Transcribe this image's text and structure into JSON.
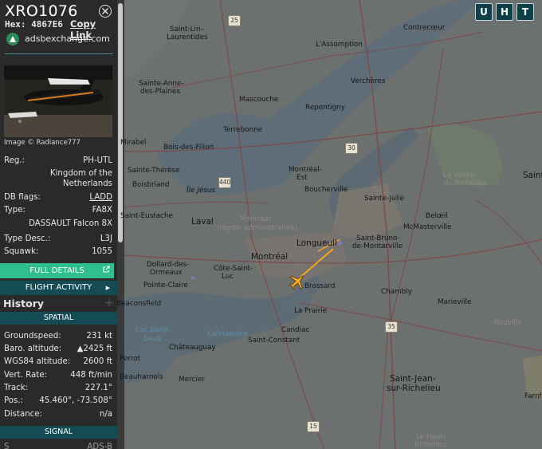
{
  "header": {
    "callsign": "XRO1076",
    "hex_label": "Hex:",
    "hex": "4867E6",
    "copy_link": "Copy Link",
    "source_site": "adsbexchange.com"
  },
  "photo": {
    "caption": "Image © Radiance777"
  },
  "details": {
    "reg_label": "Reg.:",
    "reg": "PH-UTL",
    "country": "Kingdom of the Netherlands",
    "db_flags_label": "DB flags:",
    "db_flags": "LADD",
    "type_label": "Type:",
    "type": "FA8X",
    "type_name": "DASSAULT Falcon 8X",
    "type_desc_label": "Type Desc.:",
    "type_desc": "L3J",
    "squawk_label": "Squawk:",
    "squawk": "1055"
  },
  "buttons": {
    "full_details": "FULL DETAILS",
    "flight_activity": "FLIGHT ACTIVITY"
  },
  "history": {
    "title": "History"
  },
  "spatial": {
    "title": "SPATIAL",
    "groundspeed_label": "Groundspeed:",
    "groundspeed": "231 kt",
    "baro_label": "Baro. altitude:",
    "baro": "▲2425 ft",
    "wgs_label": "WGS84 altitude:",
    "wgs": "2600 ft",
    "vrate_label": "Vert. Rate:",
    "vrate": "448 ft/min",
    "track_label": "Track:",
    "track": "227.1°",
    "pos_label": "Pos.:",
    "pos": "45.460°, -73.508°",
    "distance_label": "Distance:",
    "distance": "n/a"
  },
  "signal": {
    "title": "SIGNAL",
    "partial": "ADS-B"
  },
  "map": {
    "buttons": [
      "U",
      "H",
      "T"
    ],
    "labels": {
      "saint_lin": "Saint-Lin–",
      "laurentides": "Laurentides",
      "contrecoeur": "Contrecœur",
      "lassomption": "L'Assomption",
      "sainte_anne": "Sainte-Anne-",
      "des_plaines": "des-Plaines",
      "vercheres": "Verchères",
      "mascouche": "Mascouche",
      "repentigny": "Repentigny",
      "terrebonne": "Terrebonne",
      "mirabel": "Mirabel",
      "bois_des_filion": "Bois-des-Filion",
      "sainte_therese": "Sainte-Thérèse",
      "boisbriand": "Boisbriand",
      "montreal_est": "Montréal-",
      "montreal_est2": "Est",
      "boucherville": "Boucherville",
      "sainte_julie": "Sainte-Julie",
      "la_vallee": "La Vallée-",
      "du_richelieu": "du-Richelieu",
      "saint_edge": "Saint",
      "ile_jesus": "Île Jésus",
      "laval": "Laval",
      "montreal_region": "Montréal",
      "region_admin": "(région administrative)",
      "longueuil": "Longueuil",
      "beloeil": "Belœil",
      "mcmasterville": "McMasterville",
      "saint_eustache": "Saint-Eustache",
      "saint_bruno": "Saint-Bruno-",
      "de_montarville": "de-Montarville",
      "montreal": "Montréal",
      "dollard": "Dollard-des-",
      "ormeaux": "Ormeaux",
      "cote_saint_luc": "Côte-Saint-",
      "luc": "Luc",
      "brossard": "Brossard",
      "pointe_claire": "Pointe-Claire",
      "chambly": "Chambly",
      "marieville": "Marieville",
      "beaconsfield": "Beaconsfield",
      "la_prairie": "La Prairie",
      "lac_saint_louis": "Lac Saint-",
      "louis": "Louis",
      "kahnawake": "Kahnawake",
      "candiac": "Candiac",
      "rouville": "Rouville",
      "saint_constant": "Saint-Constant",
      "chateauguay": "Châteauguay",
      "perrot": "Perrot",
      "beauharnois": "Beauharnois",
      "mercier": "Mercier",
      "saint_jean": "Saint-Jean-",
      "sur_richelieu": "sur-Richelieu",
      "farnham": "Farnh",
      "le_haut": "Le Haut-",
      "richelieu": "Richelieu"
    },
    "shields": {
      "a25": "25",
      "a30": "30",
      "a440": "440",
      "a35": "35",
      "a15": "15"
    }
  },
  "colors": {
    "panel_bg": "#2a2a2a",
    "accent_green": "#2fbf8f",
    "accent_teal": "#144b55",
    "aircraft": "#f5a623"
  }
}
